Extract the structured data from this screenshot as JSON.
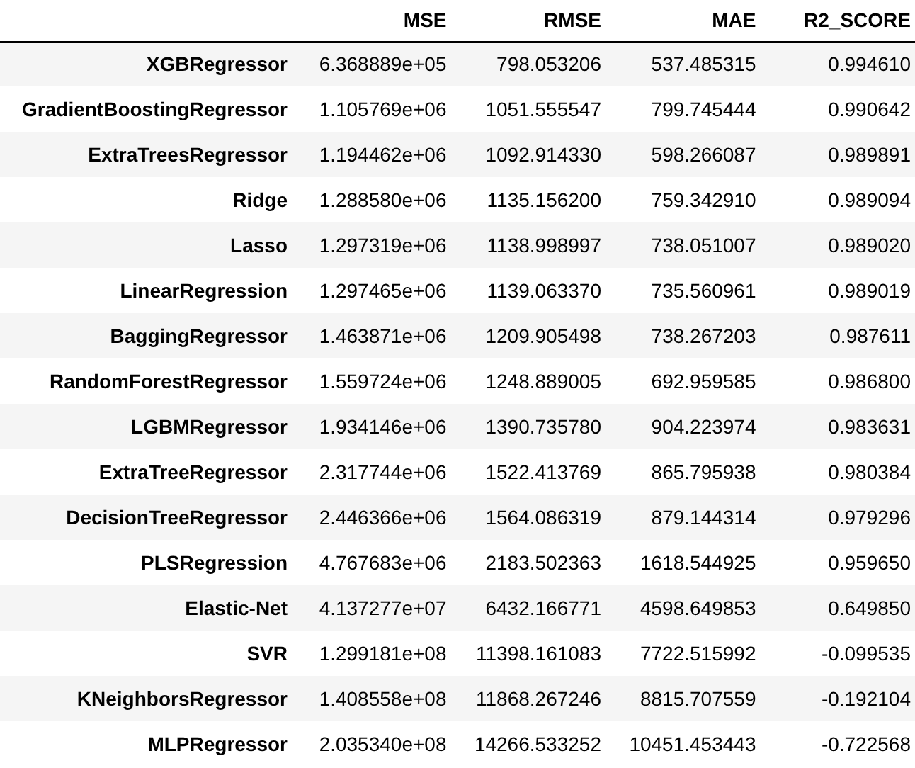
{
  "table": {
    "columns": [
      "MSE",
      "RMSE",
      "MAE",
      "R2_SCORE"
    ],
    "rows": [
      {
        "name": "XGBRegressor",
        "cells": [
          "6.368889e+05",
          "798.053206",
          "537.485315",
          "0.994610"
        ]
      },
      {
        "name": "GradientBoostingRegressor",
        "cells": [
          "1.105769e+06",
          "1051.555547",
          "799.745444",
          "0.990642"
        ]
      },
      {
        "name": "ExtraTreesRegressor",
        "cells": [
          "1.194462e+06",
          "1092.914330",
          "598.266087",
          "0.989891"
        ]
      },
      {
        "name": "Ridge",
        "cells": [
          "1.288580e+06",
          "1135.156200",
          "759.342910",
          "0.989094"
        ]
      },
      {
        "name": "Lasso",
        "cells": [
          "1.297319e+06",
          "1138.998997",
          "738.051007",
          "0.989020"
        ]
      },
      {
        "name": "LinearRegression",
        "cells": [
          "1.297465e+06",
          "1139.063370",
          "735.560961",
          "0.989019"
        ]
      },
      {
        "name": "BaggingRegressor",
        "cells": [
          "1.463871e+06",
          "1209.905498",
          "738.267203",
          "0.987611"
        ]
      },
      {
        "name": "RandomForestRegressor",
        "cells": [
          "1.559724e+06",
          "1248.889005",
          "692.959585",
          "0.986800"
        ]
      },
      {
        "name": "LGBMRegressor",
        "cells": [
          "1.934146e+06",
          "1390.735780",
          "904.223974",
          "0.983631"
        ]
      },
      {
        "name": "ExtraTreeRegressor",
        "cells": [
          "2.317744e+06",
          "1522.413769",
          "865.795938",
          "0.980384"
        ]
      },
      {
        "name": "DecisionTreeRegressor",
        "cells": [
          "2.446366e+06",
          "1564.086319",
          "879.144314",
          "0.979296"
        ]
      },
      {
        "name": "PLSRegression",
        "cells": [
          "4.767683e+06",
          "2183.502363",
          "1618.544925",
          "0.959650"
        ]
      },
      {
        "name": "Elastic-Net",
        "cells": [
          "4.137277e+07",
          "6432.166771",
          "4598.649853",
          "0.649850"
        ]
      },
      {
        "name": "SVR",
        "cells": [
          "1.299181e+08",
          "11398.161083",
          "7722.515992",
          "-0.099535"
        ]
      },
      {
        "name": "KNeighborsRegressor",
        "cells": [
          "1.408558e+08",
          "11868.267246",
          "8815.707559",
          "-0.192104"
        ]
      },
      {
        "name": "MLPRegressor",
        "cells": [
          "2.035340e+08",
          "14266.533252",
          "10451.453443",
          "-0.722568"
        ]
      }
    ]
  }
}
